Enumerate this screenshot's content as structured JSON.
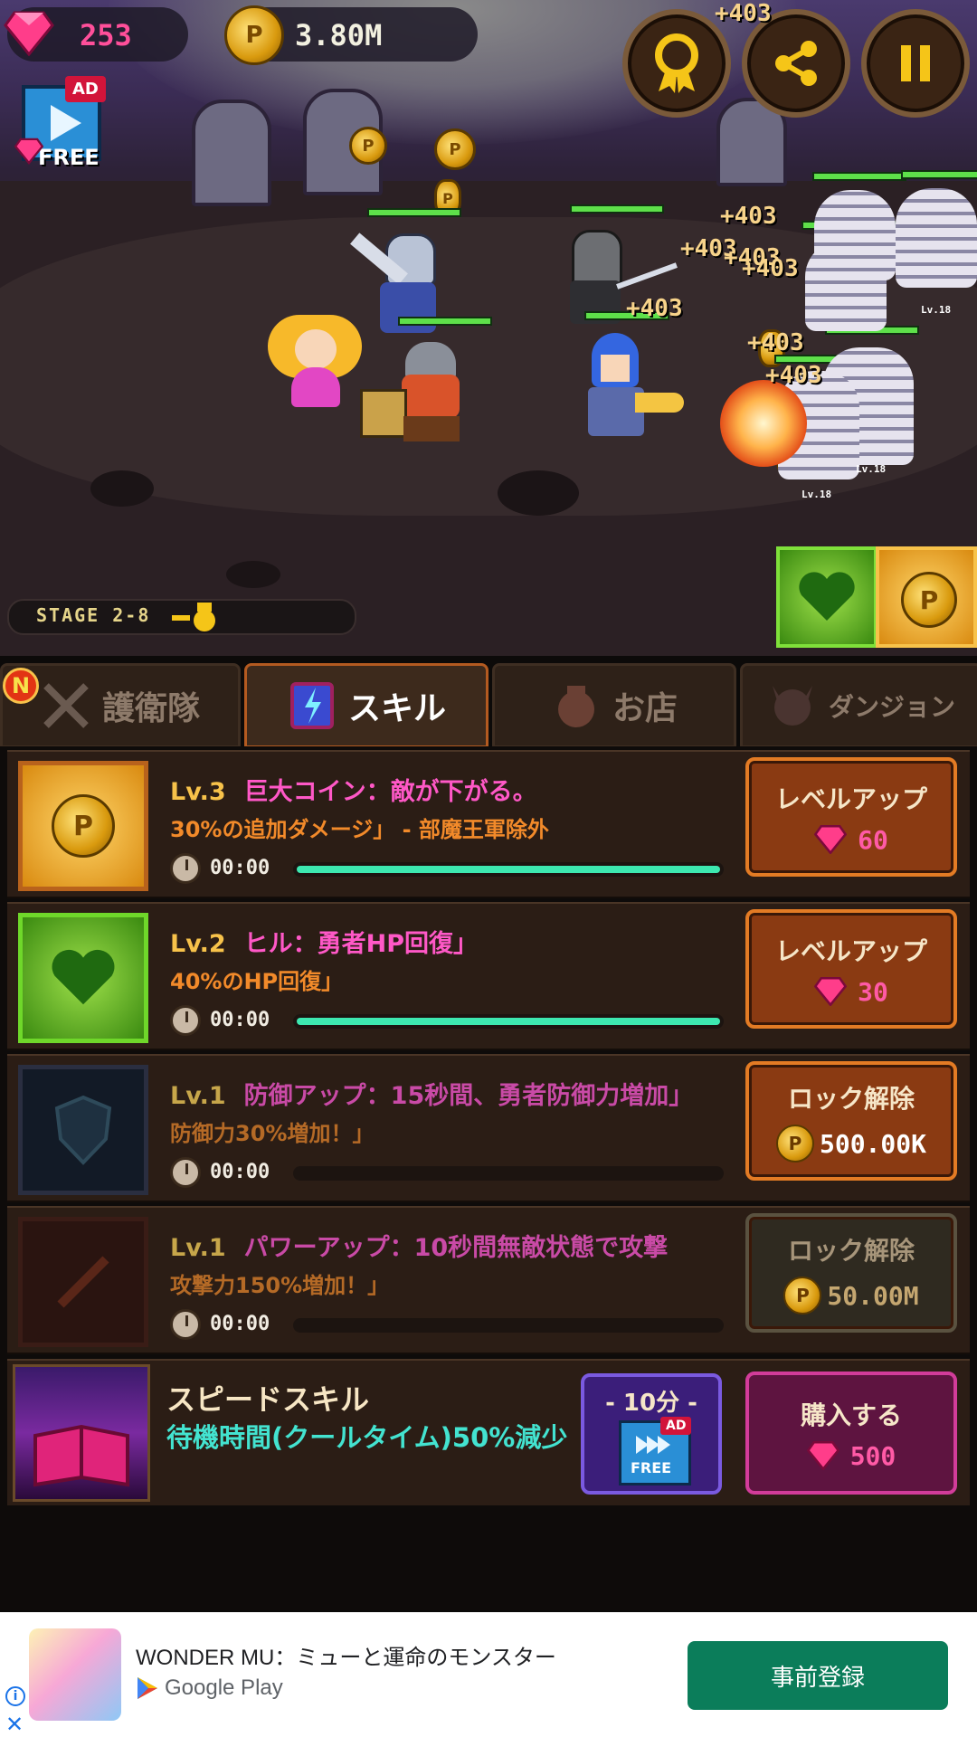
{
  "hud": {
    "gems": "253",
    "coins": "3.80M",
    "ad_badge": "AD",
    "free_label": "FREE"
  },
  "battle": {
    "damage_texts": [
      "+403",
      "+403",
      "+403",
      "+403",
      "+403",
      "+403",
      "+403",
      "+403"
    ],
    "enemy_levels": [
      "Lv.18",
      "Lv.18",
      "Lv.18"
    ],
    "stage_label": "STAGE 2-8"
  },
  "tabs": [
    {
      "label": "護衛隊",
      "badge": "N"
    },
    {
      "label": "スキル"
    },
    {
      "label": "お店"
    },
    {
      "label": "ダンジョン"
    }
  ],
  "skills": [
    {
      "level": "Lv.3",
      "name": "巨大コイン：敵が下がる。",
      "desc": "30%の追加ダメージ」 - 部魔王軍除外",
      "time": "00:00",
      "progress": 1.0,
      "button": "レベルアップ",
      "price": "60",
      "currency": "gem"
    },
    {
      "level": "Lv.2",
      "name": "ヒル：勇者HP回復」",
      "desc": "40%のHP回復」",
      "time": "00:00",
      "progress": 1.0,
      "button": "レベルアップ",
      "price": "30",
      "currency": "gem"
    },
    {
      "level": "Lv.1",
      "name": "防御アップ：15秒間、勇者防御力増加」",
      "desc": "防御力30%増加！」",
      "time": "00:00",
      "progress": 0,
      "button": "ロック解除",
      "price": "500.00K",
      "currency": "coin"
    },
    {
      "level": "Lv.1",
      "name": "パワーアップ：10秒間無敵状態で攻撃",
      "desc": "攻撃力150%増加！」",
      "time": "00:00",
      "progress": 0,
      "button": "ロック解除",
      "price": "50.00M",
      "currency": "coin"
    }
  ],
  "speed_skill": {
    "title": "スピードスキル",
    "desc": "待機時間(クールタイム)50%減少",
    "ad_duration": "- 10分 -",
    "ad_badge": "AD",
    "ad_free": "FREE",
    "buy_label": "購入する",
    "buy_price": "500"
  },
  "banner_ad": {
    "app_name": "WONDER MU：ミューと運命のモンスター",
    "store": "Google Play",
    "cta": "事前登録"
  }
}
